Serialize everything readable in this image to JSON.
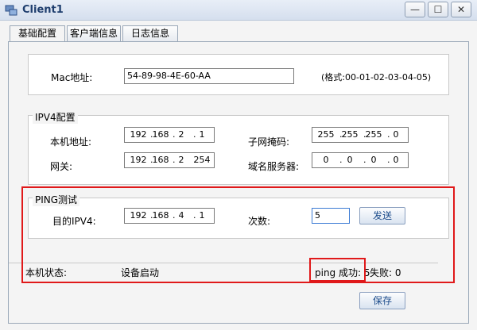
{
  "window": {
    "title": "Client1",
    "controls": {
      "minimize": "—",
      "maximize": "☐",
      "close": "✕"
    }
  },
  "tabs": [
    {
      "label": "基础配置",
      "active": true
    },
    {
      "label": "客户端信息",
      "active": false
    },
    {
      "label": "日志信息",
      "active": false
    }
  ],
  "mac": {
    "label": "Mac地址:",
    "value": "54-89-98-4E-60-AA",
    "format_hint": "(格式:00-01-02-03-04-05)"
  },
  "ipv4": {
    "legend": "IPV4配置",
    "local_ip": {
      "label": "本机地址:",
      "octets": [
        "192",
        "168",
        "2",
        "1"
      ]
    },
    "subnet_mask": {
      "label": "子网掩码:",
      "octets": [
        "255",
        "255",
        "255",
        "0"
      ]
    },
    "gateway": {
      "label": "网关:",
      "octets": [
        "192",
        "168",
        "2",
        "254"
      ]
    },
    "dns": {
      "label": "域名服务器:",
      "octets": [
        "0",
        "0",
        "0",
        "0"
      ]
    }
  },
  "ping": {
    "legend": "PING测试",
    "target": {
      "label": "目的IPV4:",
      "octets": [
        "192",
        "168",
        "4",
        "1"
      ]
    },
    "count": {
      "label": "次数:",
      "value": "5"
    },
    "send_button": "发送"
  },
  "status": {
    "label": "本机状态:",
    "value": "设备启动",
    "ping_success": "ping 成功: 5",
    "fail": "失败: 0"
  },
  "save_button": "保存",
  "colors": {
    "highlight": "#e0191a",
    "title": "#1f3e6e",
    "button_text": "#1a4a8a"
  }
}
